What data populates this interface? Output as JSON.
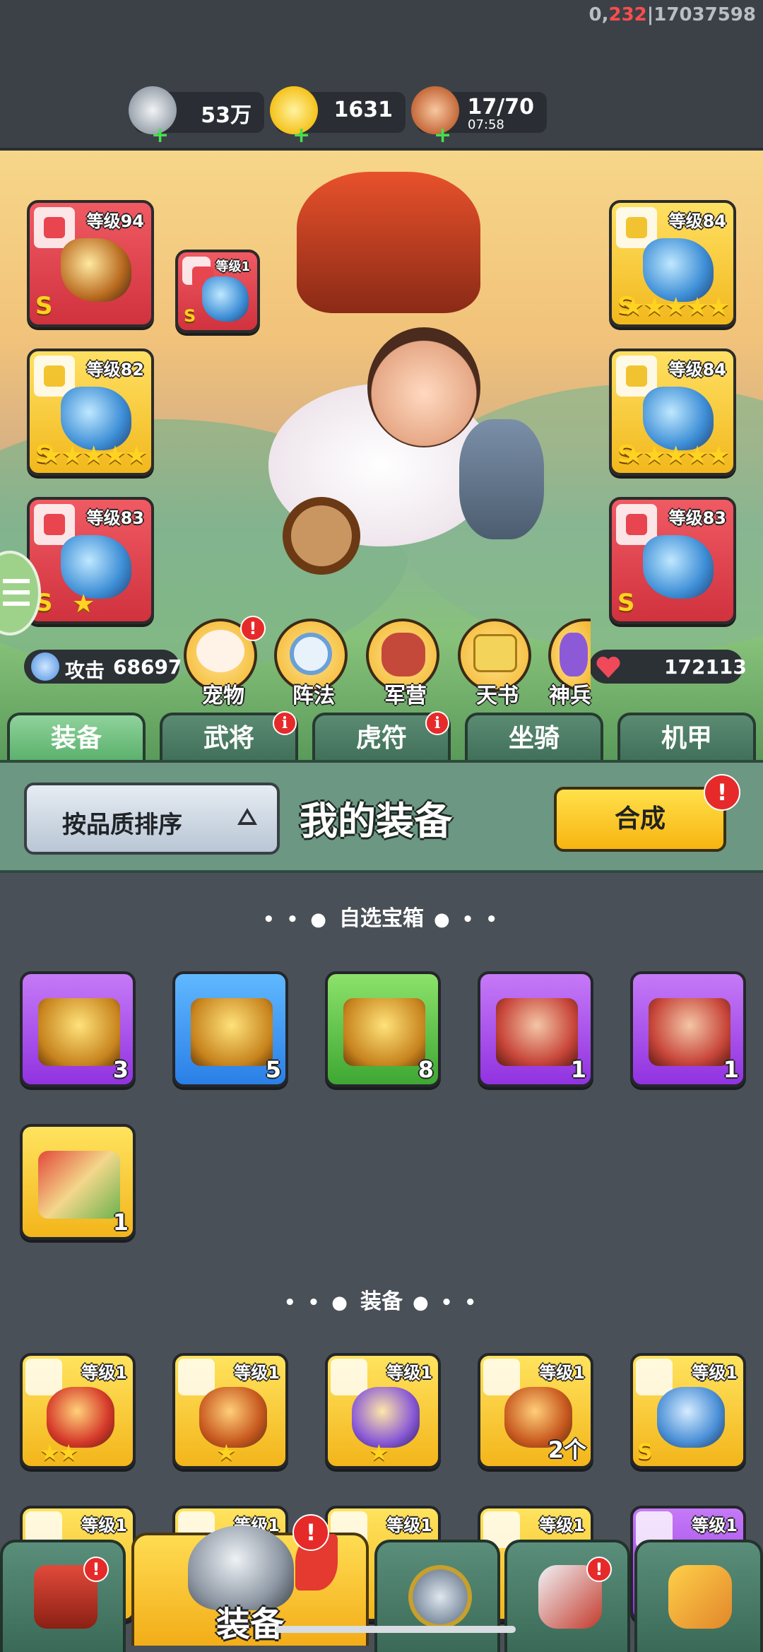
{
  "debug": {
    "prefix": "0,",
    "red": "232",
    "suffix": "|17037598"
  },
  "resources": [
    {
      "name": "silver-coin",
      "value": "53万",
      "sub": ""
    },
    {
      "name": "gold-ingot",
      "value": "1631",
      "sub": ""
    },
    {
      "name": "meat-stamina",
      "value": "17/70",
      "sub": "07:58"
    }
  ],
  "equipped_left": [
    {
      "level": "等级94",
      "rarity": "S",
      "stars": "",
      "color": "red"
    },
    {
      "level": "等级82",
      "rarity": "S",
      "stars": "★★★★★",
      "color": "gold"
    },
    {
      "level": "等级83",
      "rarity": "S",
      "stars": "★",
      "color": "red"
    }
  ],
  "equipped_small": {
    "level": "等级1",
    "rarity": "S"
  },
  "equipped_right": [
    {
      "level": "等级84",
      "rarity": "S",
      "stars": "★★★★★",
      "color": "gold"
    },
    {
      "level": "等级84",
      "rarity": "S",
      "stars": "★★★★★",
      "color": "gold"
    },
    {
      "level": "等级83",
      "rarity": "S",
      "stars": "",
      "color": "red"
    }
  ],
  "stats": {
    "attack_label": "攻击",
    "attack": "68697",
    "hp": "172113"
  },
  "functions": [
    {
      "label": "宠物",
      "alert": "!"
    },
    {
      "label": "阵法",
      "alert": ""
    },
    {
      "label": "军营",
      "alert": ""
    },
    {
      "label": "天书",
      "alert": ""
    },
    {
      "label": "神兵",
      "alert": ""
    }
  ],
  "tabs": [
    {
      "label": "装备",
      "active": true,
      "alert": ""
    },
    {
      "label": "武将",
      "active": false,
      "alert": "i"
    },
    {
      "label": "虎符",
      "active": false,
      "alert": "i"
    },
    {
      "label": "坐骑",
      "active": false,
      "alert": ""
    },
    {
      "label": "机甲",
      "active": false,
      "alert": ""
    }
  ],
  "control": {
    "sort_label": "按品质排序",
    "title": "我的装备",
    "synth_label": "合成",
    "synth_alert": "!"
  },
  "sections": {
    "chest_title": "自选宝箱",
    "equip_title": "装备",
    "dots_left": "• • ●",
    "dots_right": "● • •"
  },
  "chests": [
    {
      "color": "purple",
      "count": "3"
    },
    {
      "color": "blue",
      "count": "5"
    },
    {
      "color": "green",
      "count": "8"
    },
    {
      "color": "purple",
      "count": "1"
    },
    {
      "color": "purple",
      "count": "1"
    },
    {
      "color": "yellow",
      "count": "1"
    }
  ],
  "equipment": [
    {
      "level": "等级1",
      "stars": "★★",
      "extra": "",
      "rarity": ""
    },
    {
      "level": "等级1",
      "stars": "★",
      "extra": "",
      "rarity": ""
    },
    {
      "level": "等级1",
      "stars": "★",
      "extra": "",
      "rarity": ""
    },
    {
      "level": "等级1",
      "stars": "",
      "extra": "2个",
      "rarity": ""
    },
    {
      "level": "等级1",
      "stars": "",
      "extra": "",
      "rarity": "S"
    }
  ],
  "equipment_row2": [
    {
      "level": "等级1",
      "color": "yellow"
    },
    {
      "level": "等级1",
      "color": "yellow"
    },
    {
      "level": "等级1",
      "color": "yellow"
    },
    {
      "level": "等级1",
      "color": "yellow"
    },
    {
      "level": "等级1",
      "color": "purple"
    }
  ],
  "nav": [
    {
      "name": "shop-gate",
      "label": "",
      "alert": "!"
    },
    {
      "name": "equipment",
      "label": "装备",
      "alert": "!"
    },
    {
      "name": "battle-swords",
      "label": "",
      "alert": ""
    },
    {
      "name": "weapon-stars",
      "label": "",
      "alert": "!"
    },
    {
      "name": "upgrade-fist",
      "label": "",
      "alert": ""
    }
  ]
}
